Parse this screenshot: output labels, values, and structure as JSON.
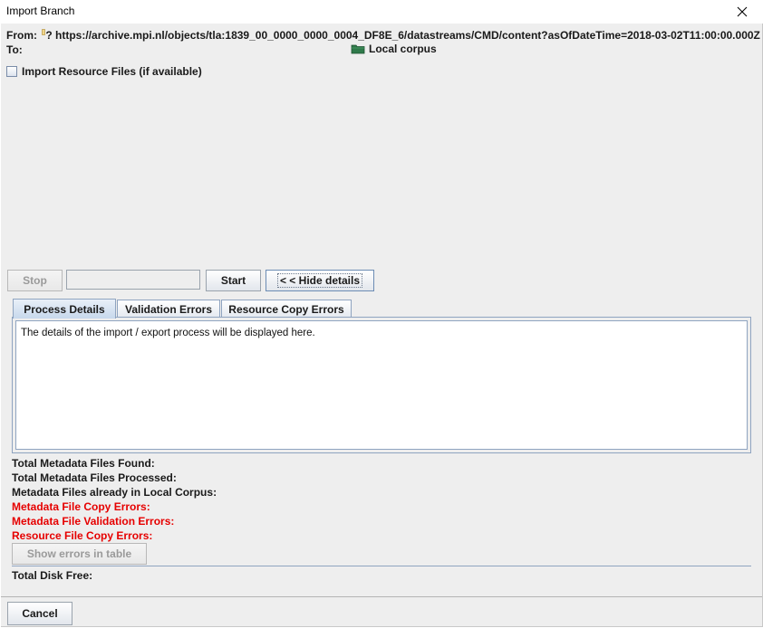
{
  "window": {
    "title": "Import Branch",
    "close_glyph": "✕"
  },
  "from": {
    "label": "From:",
    "prefix": "?",
    "value": "https://archive.mpi.nl/objects/tla:1839_00_0000_0000_0004_DF8E_6/datastreams/CMD/content?asOfDateTime=2018-03-02T11:00:00.000Z"
  },
  "to": {
    "label": "To:",
    "value": "Local corpus",
    "icon": "folder-icon",
    "icon_color": "#2f7a4a"
  },
  "options": {
    "import_resources_label": "Import Resource Files (if available)",
    "import_resources_checked": false
  },
  "controls": {
    "stop_label": "Stop",
    "start_label": "Start",
    "hide_details_label": "< < Hide details",
    "progress": 0
  },
  "tabs": [
    {
      "label": "Process Details",
      "active": true
    },
    {
      "label": "Validation Errors",
      "active": false
    },
    {
      "label": "Resource Copy Errors",
      "active": false
    }
  ],
  "details_text": "The details of the import / export process will be displayed here.",
  "stats": {
    "total_found": "Total Metadata Files Found:",
    "total_processed": "Total Metadata Files Processed:",
    "already_in_corpus": "Metadata Files already in Local Corpus:",
    "copy_errors": "Metadata File Copy Errors:",
    "validation_errors": "Metadata File Validation Errors:",
    "resource_copy_errors": "Resource File Copy Errors:",
    "error_color": "#e60000"
  },
  "show_errors_label": "Show errors in table",
  "disk_free_label": "Total Disk Free:",
  "cancel_label": "Cancel"
}
